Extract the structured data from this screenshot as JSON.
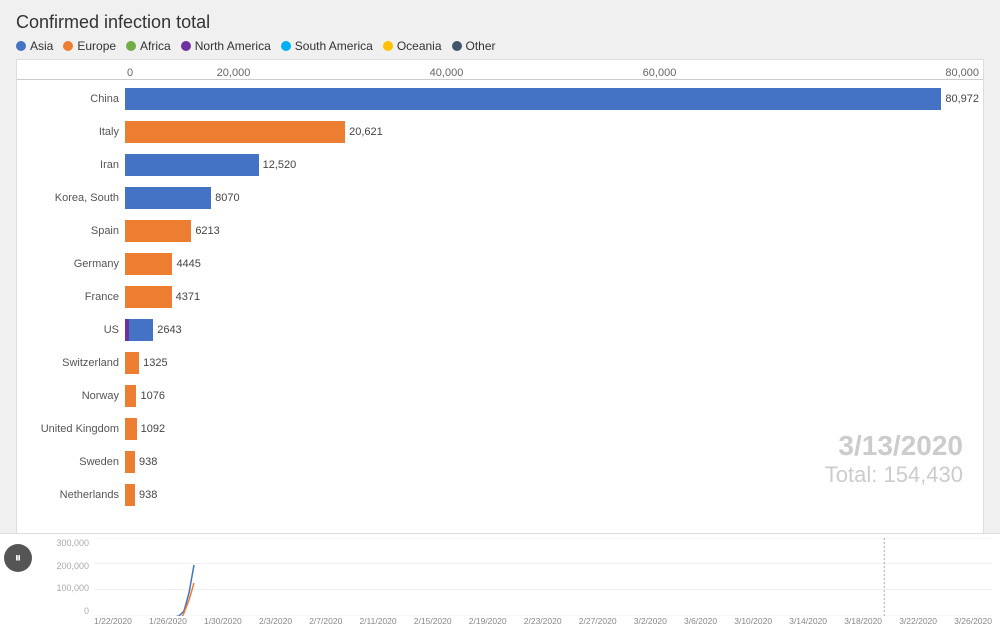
{
  "title": "Confirmed infection total",
  "legend": [
    {
      "label": "Asia",
      "color": "#4472c4"
    },
    {
      "label": "Europe",
      "color": "#ed7d31"
    },
    {
      "label": "Africa",
      "color": "#70ad47"
    },
    {
      "label": "North America",
      "color": "#7030a0"
    },
    {
      "label": "South America",
      "color": "#00b0f0"
    },
    {
      "label": "Oceania",
      "color": "#ffc000"
    },
    {
      "label": "Other",
      "color": "#44546a"
    }
  ],
  "xaxis": {
    "labels": [
      "0",
      "20,000",
      "40,000",
      "60,000",
      "80,000"
    ],
    "max": 80000
  },
  "bars": [
    {
      "country": "China",
      "value": 80972,
      "color": "#4472c4",
      "label": "80,972"
    },
    {
      "country": "Italy",
      "value": 20621,
      "color": "#ed7d31",
      "label": "20,621"
    },
    {
      "country": "Iran",
      "value": 12520,
      "color": "#4472c4",
      "label": "12,520"
    },
    {
      "country": "Korea, South",
      "value": 8070,
      "color": "#4472c4",
      "label": "8070"
    },
    {
      "country": "Spain",
      "value": 6213,
      "color": "#ed7d31",
      "label": "6213"
    },
    {
      "country": "Germany",
      "value": 4445,
      "color": "#ed7d31",
      "label": "4445"
    },
    {
      "country": "France",
      "value": 4371,
      "color": "#ed7d31",
      "label": "4371"
    },
    {
      "country": "US",
      "value": 2643,
      "color_1": "#7030a0",
      "color_2": "#4472c4",
      "label": "2643",
      "stacked": true,
      "v1": 400,
      "v2": 2243
    },
    {
      "country": "Switzerland",
      "value": 1325,
      "color": "#ed7d31",
      "label": "1325"
    },
    {
      "country": "Norway",
      "value": 1076,
      "color": "#ed7d31",
      "label": "1076"
    },
    {
      "country": "United Kingdom",
      "value": 1092,
      "color": "#ed7d31",
      "label": "1092"
    },
    {
      "country": "Sweden",
      "value": 938,
      "color": "#ed7d31",
      "label": "938"
    },
    {
      "country": "Netherlands",
      "value": 938,
      "color": "#ed7d31",
      "label": "938"
    }
  ],
  "date_overlay": {
    "date": "3/13/2020",
    "total": "Total: 154,430"
  },
  "timeline": {
    "y_labels": [
      "300,000",
      "200,000",
      "100,000",
      "0"
    ],
    "x_labels": [
      "1/22/2020",
      "1/26/2020",
      "1/30/2020",
      "2/3/2020",
      "2/7/2020",
      "2/11/2020",
      "2/15/2020",
      "2/19/2020",
      "2/23/2020",
      "2/27/2020",
      "3/2/2020",
      "3/6/2020",
      "3/10/2020",
      "3/14/2020",
      "3/18/2020",
      "3/22/2020",
      "3/26/2020"
    ]
  },
  "play_button": {
    "icon": "⏸"
  }
}
